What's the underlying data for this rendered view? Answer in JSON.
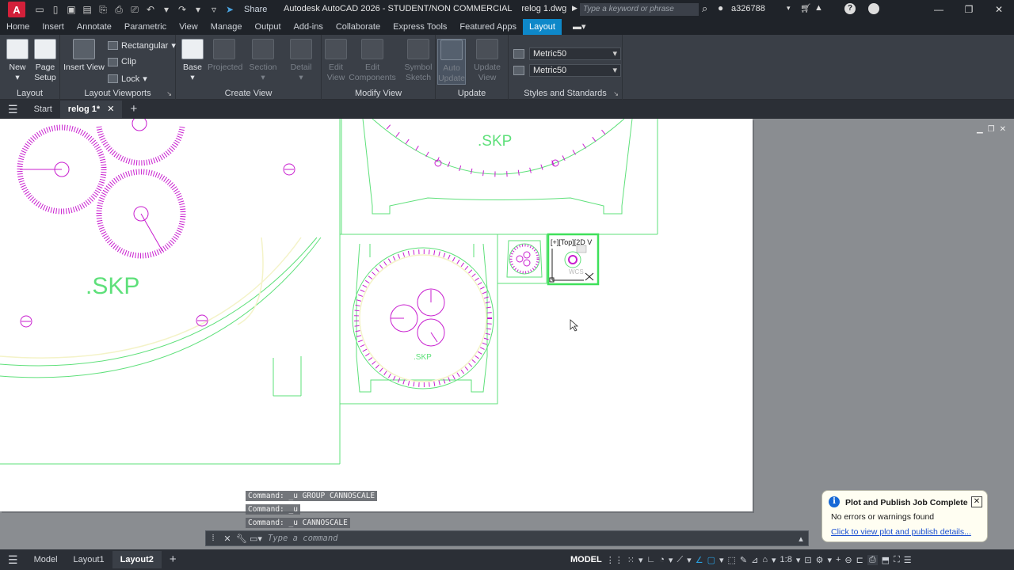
{
  "titlebar": {
    "app_logo": "A",
    "share_label": "Share",
    "title": "Autodesk AutoCAD 2026 - STUDENT/NON COMMERCIAL    relog 1.dwg",
    "search_placeholder": "Type a keyword or phrase",
    "username": "a326788"
  },
  "ribbon_tabs": [
    "Home",
    "Insert",
    "Annotate",
    "Parametric",
    "View",
    "Manage",
    "Output",
    "Add-ins",
    "Collaborate",
    "Express Tools",
    "Featured Apps",
    "Layout"
  ],
  "active_ribbon_tab": "Layout",
  "ribbon": {
    "layout_panel": {
      "title": "Layout",
      "new": "New",
      "page_setup_1": "Page",
      "page_setup_2": "Setup"
    },
    "viewports_panel": {
      "title": "Layout Viewports",
      "insert_view": "Insert View",
      "rectangular": "Rectangular",
      "clip": "Clip",
      "lock": "Lock"
    },
    "create_view_panel": {
      "title": "Create View",
      "base": "Base",
      "projected": "Projected",
      "section": "Section",
      "detail": "Detail"
    },
    "modify_view_panel": {
      "title": "Modify View",
      "edit_view_1": "Edit",
      "edit_view_2": "View",
      "edit_components_1": "Edit",
      "edit_components_2": "Components",
      "symbol_sketch_1": "Symbol",
      "symbol_sketch_2": "Sketch"
    },
    "update_panel": {
      "title": "Update",
      "auto_update_1": "Auto",
      "auto_update_2": "Update",
      "update_view_1": "Update",
      "update_view_2": "View"
    },
    "styles_panel": {
      "title": "Styles and Standards",
      "style1": "Metric50",
      "style2": "Metric50"
    }
  },
  "file_tabs": {
    "start": "Start",
    "active": "relog 1*"
  },
  "drawing": {
    "label_skp": ".SKP",
    "viewport_label": "[+][Top][2D V",
    "wcs_label": "WCS"
  },
  "command_history": [
    "Command: _u GROUP CANNOSCALE",
    "Command: _u",
    "Command: _u CANNOSCALE"
  ],
  "command_placeholder": "Type a command",
  "status_tabs": [
    "Model",
    "Layout1",
    "Layout2"
  ],
  "active_status_tab": "Layout2",
  "status": {
    "model_label": "MODEL",
    "scale": "1:8"
  },
  "notification": {
    "title": "Plot and Publish Job Complete",
    "message": "No errors or warnings found",
    "link": "Click to view plot and publish details..."
  },
  "colors": {
    "accent": "#0e88c9",
    "drawing_green": "#5ee07a",
    "drawing_magenta": "#c81ecf",
    "drawing_yellow": "#f4f3c8"
  }
}
